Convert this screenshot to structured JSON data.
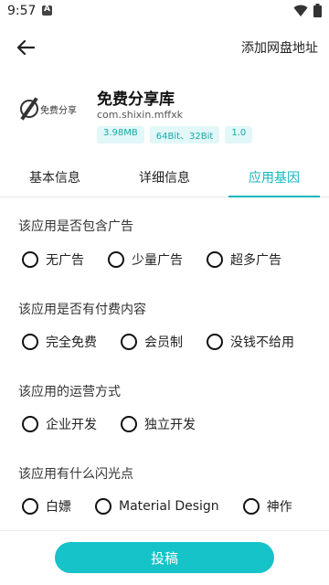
{
  "status_bar": {
    "time": "9:57"
  },
  "header": {
    "add_link_label": "添加网盘地址"
  },
  "app": {
    "name": "免费分享库",
    "package": "com.shixin.mffxk",
    "logo_text": "免费分享",
    "tags": [
      "3.98MB",
      "64Bit、32Bit",
      "1.0"
    ]
  },
  "tabs": [
    {
      "label": "基本信息",
      "active": false
    },
    {
      "label": "详细信息",
      "active": false
    },
    {
      "label": "应用基因",
      "active": true
    }
  ],
  "sections": [
    {
      "title": "该应用是否包含广告",
      "options": [
        "无广告",
        "少量广告",
        "超多广告"
      ]
    },
    {
      "title": "该应用是否有付费内容",
      "options": [
        "完全免费",
        "会员制",
        "没钱不给用"
      ]
    },
    {
      "title": "该应用的运营方式",
      "options": [
        "企业开发",
        "独立开发"
      ]
    },
    {
      "title": "该应用有什么闪光点",
      "options": [
        "白嫖",
        "Material Design",
        "神作"
      ]
    }
  ],
  "submit_label": "投稿",
  "accent_color": "#15b5bd"
}
